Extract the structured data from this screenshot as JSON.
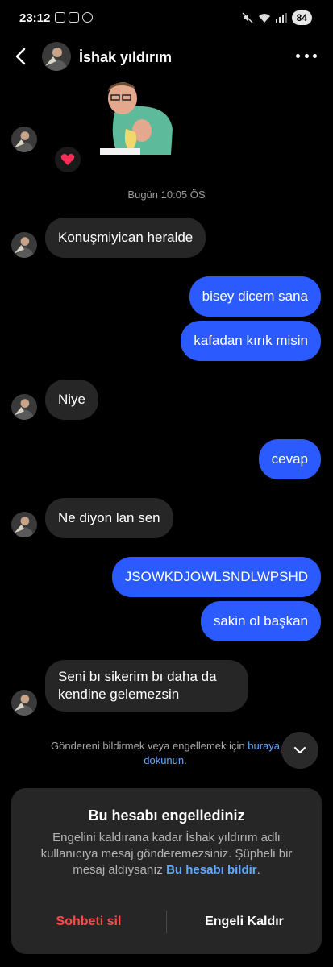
{
  "status_bar": {
    "time": "23:12",
    "battery": "84"
  },
  "header": {
    "contact_name": "İshak yıldırım"
  },
  "reaction_emoji": "❤️",
  "timestamp": "Bugün 10:05 ÖS",
  "messages": [
    {
      "side": "in",
      "text": "Konuşmiyican heralde"
    },
    {
      "side": "out",
      "text": "bisey dicem sana"
    },
    {
      "side": "out",
      "text": "kafadan kırık misin"
    },
    {
      "side": "in",
      "text": "Niye"
    },
    {
      "side": "out",
      "text": "cevap"
    },
    {
      "side": "in",
      "text": "Ne diyon lan sen"
    },
    {
      "side": "out",
      "text": "JSOWKDJOWLSNDLWPSHD"
    },
    {
      "side": "out",
      "text": "sakin ol başkan"
    },
    {
      "side": "in",
      "text": "Seni bı sikerim bı daha da kendine gelemezsin"
    }
  ],
  "report_hint": {
    "prefix": "Göndereni bildirmek veya engellemek için ",
    "link": "buraya dokunun",
    "suffix": "."
  },
  "blocked_card": {
    "title": "Bu hesabı engellediniz",
    "body": "Engelini kaldırana kadar İshak yıldırım adlı kullanıcıya mesaj gönderemezsiniz. Şüpheli bir mesaj aldıysanız ",
    "link": "Bu hesabı bildir",
    "body_end": ".",
    "delete_label": "Sohbeti sil",
    "unblock_label": "Engeli Kaldır"
  },
  "colors": {
    "background": "#000000",
    "incoming_bubble": "#262626",
    "outgoing_bubble": "#2b5bff",
    "link": "#5fa8ff",
    "danger": "#ff4a4a"
  }
}
